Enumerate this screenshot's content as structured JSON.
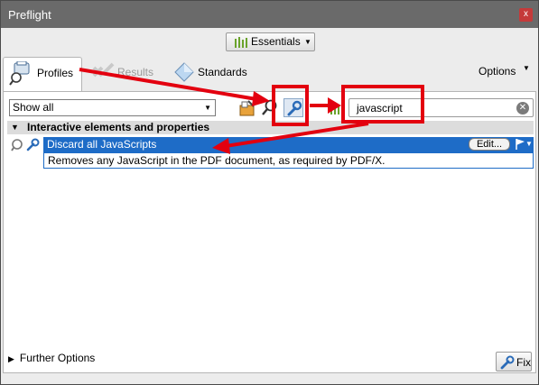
{
  "window": {
    "title": "Preflight",
    "close_label": "x"
  },
  "workspace": {
    "label": "Essentials"
  },
  "tabs": [
    {
      "label": "Profiles",
      "icon": "profiles-icon",
      "active": true
    },
    {
      "label": "Results",
      "icon": "results-icon",
      "active": false
    },
    {
      "label": "Standards",
      "icon": "standards-icon",
      "active": false
    }
  ],
  "options": {
    "label": "Options"
  },
  "filter": {
    "selected": "Show all"
  },
  "search": {
    "value": "javascript"
  },
  "group": {
    "label": "Interactive elements and properties"
  },
  "fixup": {
    "label": "Discard all JavaScripts",
    "edit_label": "Edit...",
    "description": "Removes any JavaScript in the PDF document, as required by PDF/X."
  },
  "footer": {
    "further_options": "Further Options",
    "fix_label": "Fix"
  },
  "colors": {
    "selection": "#1e6cc7",
    "annotation": "#e3000f",
    "titlebar": "#6a6a6a"
  }
}
